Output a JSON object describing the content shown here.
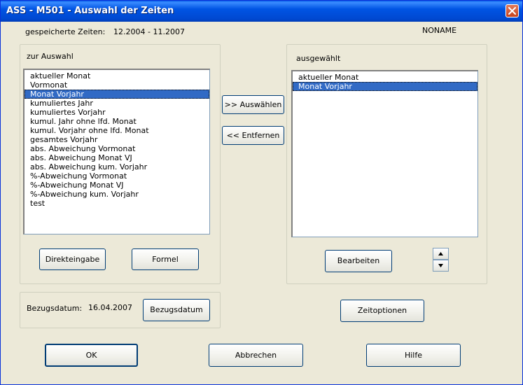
{
  "window": {
    "title": "ASS - M501 - Auswahl der Zeiten"
  },
  "header": {
    "saved_label": "gespeicherte Zeiten:",
    "saved_range": "12.2004 - 11.2007",
    "profile_name": "NONAME"
  },
  "available": {
    "label": "zur Auswahl",
    "items": [
      "aktueller Monat",
      "Vormonat",
      "Monat Vorjahr",
      "kumuliertes Jahr",
      "kumuliertes Vorjahr",
      "kumul. Jahr ohne lfd. Monat",
      "kumul. Vorjahr ohne lfd. Monat",
      "gesamtes Vorjahr",
      "abs. Abweichung Vormonat",
      "abs. Abweichung Monat VJ",
      "abs. Abweichung kum. Vorjahr",
      "%-Abweichung Vormonat",
      "%-Abweichung Monat VJ",
      "%-Abweichung kum. Vorjahr",
      "test"
    ],
    "selected_item": "Monat Vorjahr",
    "direct_entry_button": "Direkteingabe",
    "formula_button": "Formel"
  },
  "transfer": {
    "select_button": ">> Auswählen",
    "remove_button": "<< Entfernen"
  },
  "chosen": {
    "label": "ausgewählt",
    "items": [
      "aktueller Monat",
      "Monat Vorjahr"
    ],
    "selected_item": "Monat Vorjahr",
    "edit_button": "Bearbeiten"
  },
  "reference": {
    "label": "Bezugsdatum:",
    "date": "16.04.2007",
    "button": "Bezugsdatum"
  },
  "time_options_button": "Zeitoptionen",
  "footer": {
    "ok": "OK",
    "cancel": "Abbrechen",
    "help": "Hilfe"
  },
  "icons": {
    "close": "close-icon",
    "up": "arrow-up-icon",
    "down": "arrow-down-icon"
  }
}
